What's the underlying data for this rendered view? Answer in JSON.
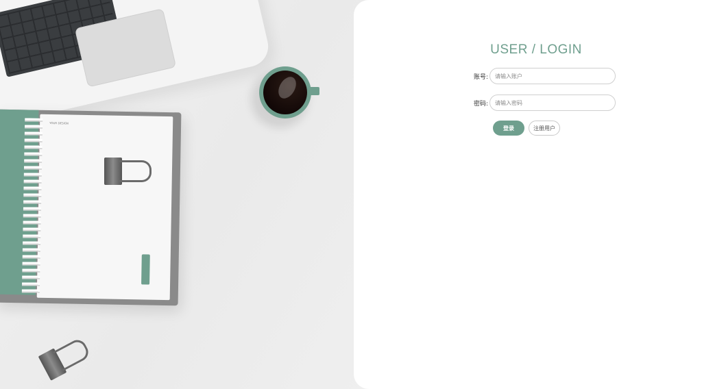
{
  "login": {
    "title": "USER / LOGIN",
    "username": {
      "label": "账号:",
      "placeholder": "请输入账户",
      "value": ""
    },
    "password": {
      "label": "密码:",
      "placeholder": "请输入密码",
      "value": ""
    },
    "login_button": "登录",
    "register_button": "注册用户"
  },
  "theme": {
    "accent": "#6f9f8e",
    "panel_background": "#ffffff",
    "page_background": "#eeeeee"
  },
  "decor": {
    "notebook_page_title": "YOUR DESIGN",
    "icons": [
      "laptop-icon",
      "coffee-cup-icon",
      "notebook-icon",
      "binder-clip-icon"
    ]
  }
}
